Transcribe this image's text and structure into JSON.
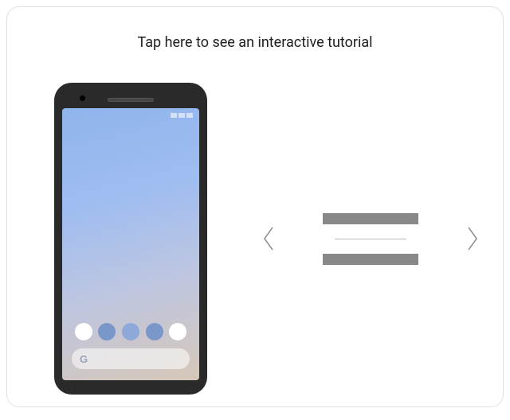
{
  "heading": "Tap here to see an interactive tutorial",
  "search": {
    "logo": "G"
  }
}
